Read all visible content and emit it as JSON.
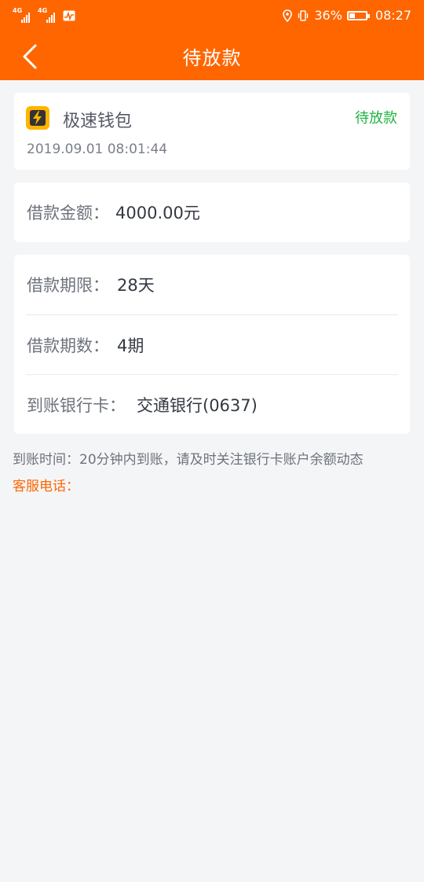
{
  "status_bar": {
    "net1": "4G",
    "net2": "4G",
    "battery_percent": "36%",
    "time": "08:27",
    "battery_level": 0.36
  },
  "nav": {
    "back_icon": "chevron-left-icon",
    "title": "待放款"
  },
  "order": {
    "app_icon": "lightning-icon",
    "app_name": "极速钱包",
    "status": "待放款",
    "datetime": "2019.09.01 08:01:44"
  },
  "amount": {
    "label": "借款金额：",
    "value": "4000.00元"
  },
  "details": [
    {
      "label": "借款期限：",
      "value": "28天"
    },
    {
      "label": "借款期数：",
      "value": "4期"
    },
    {
      "label": "到账银行卡：",
      "value": "交通银行(0637)"
    }
  ],
  "notice": "到账时间：20分钟内到账，请及时关注银行卡账户余额动态",
  "service_label": "客服电话：",
  "colors": {
    "brand": "#ff6600",
    "status_green": "#1fb341",
    "logo_yellow": "#ffb400"
  }
}
